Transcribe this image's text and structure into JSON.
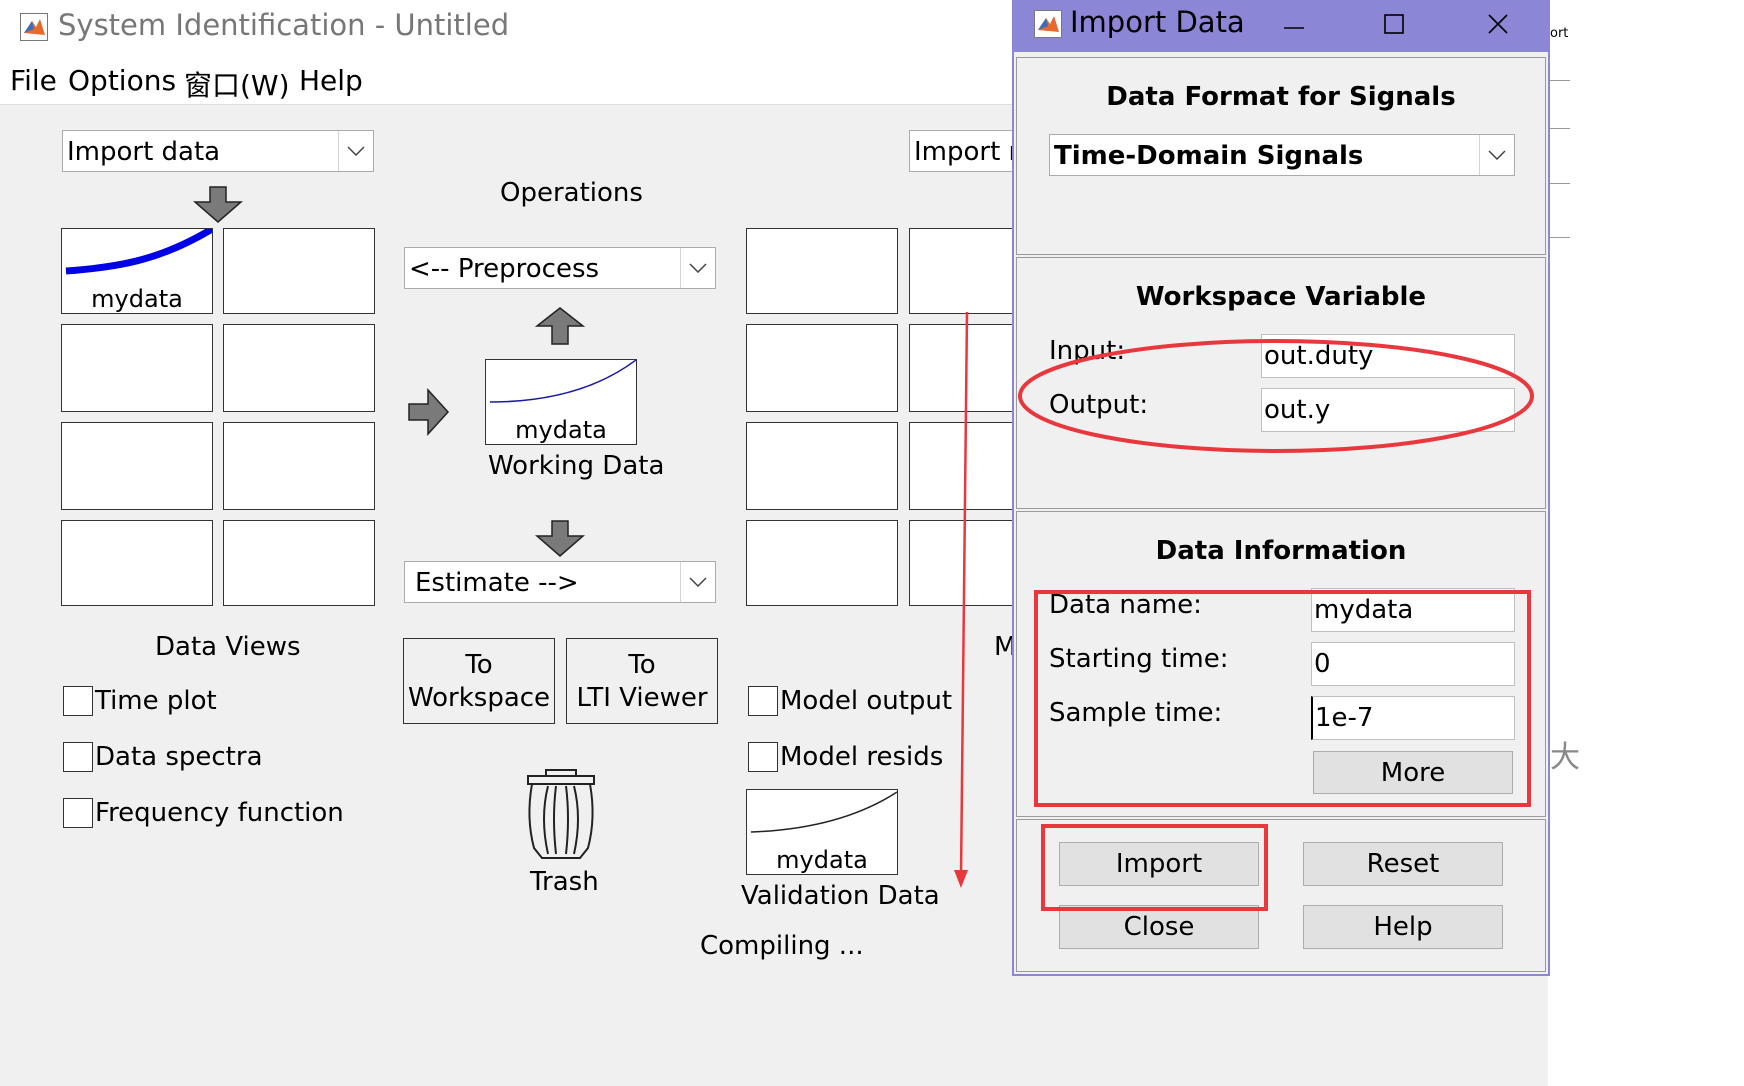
{
  "main_window": {
    "title": "System Identification - Untitled",
    "menu": [
      "File",
      "Options",
      "窗口(W)",
      "Help"
    ],
    "import_data_combo": "Import data",
    "import_models_combo": "Import mo",
    "operations_label": "Operations",
    "preprocess_combo": "<-- Preprocess",
    "estimate_combo": "Estimate -->",
    "data_board_item": "mydata",
    "working_data": {
      "name": "mydata",
      "caption": "Working Data"
    },
    "data_views_label": "Data Views",
    "checkboxes_data": [
      "Time plot",
      "Data spectra",
      "Frequency function"
    ],
    "to_workspace": [
      "To",
      "Workspace"
    ],
    "to_lti_viewer": [
      "To",
      "LTI Viewer"
    ],
    "checkboxes_model": [
      "Model output",
      "Model resids"
    ],
    "trash_label": "Trash",
    "validation_data": {
      "name": "mydata",
      "caption": "Validation Data"
    },
    "model_views_label": "M",
    "status": "Compiling ...",
    "peek_right_top": "ort",
    "peek_right_mid": "大"
  },
  "dialog": {
    "title": "Import Data",
    "title_bar_color": "#8c86d6",
    "data_format": {
      "title": "Data Format for Signals",
      "selected": "Time-Domain Signals"
    },
    "workspace_variable": {
      "title": "Workspace Variable",
      "input_label": "Input:",
      "input_value": "out.duty",
      "output_label": "Output:",
      "output_value": "out.y"
    },
    "data_information": {
      "title": "Data Information",
      "name_label": "Data name:",
      "name_value": "mydata",
      "start_label": "Starting time:",
      "start_value": "0",
      "sample_label": "Sample time:",
      "sample_value": "1e-7",
      "more_button": "More"
    },
    "buttons": {
      "import": "Import",
      "reset": "Reset",
      "close": "Close",
      "help": "Help"
    }
  },
  "annotation_color": "#e8383d"
}
